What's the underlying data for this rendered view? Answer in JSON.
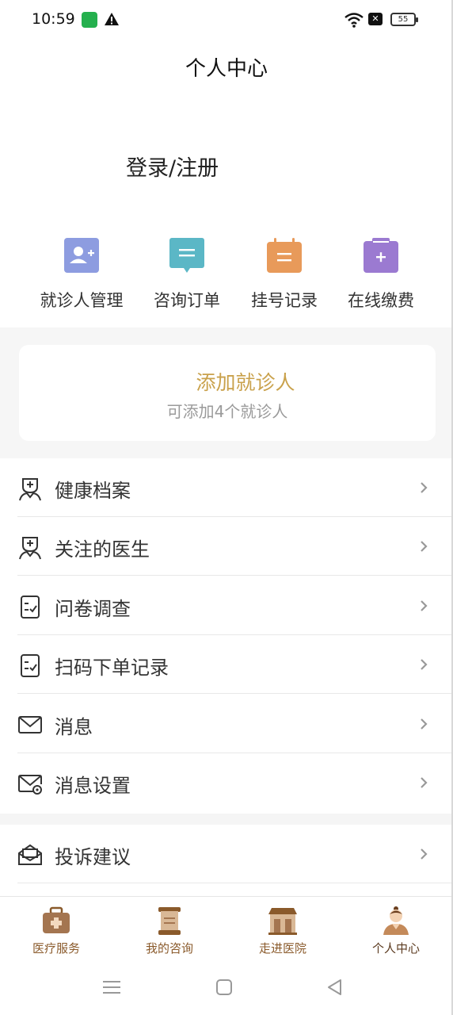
{
  "status_bar": {
    "time": "10:59",
    "battery": "55"
  },
  "header": {
    "title": "个人中心"
  },
  "login": {
    "label": "登录/注册"
  },
  "quick_actions": [
    {
      "label": "就诊人管理",
      "icon": "patient-manage-icon",
      "color": "#8d9ce0"
    },
    {
      "label": "咨询订单",
      "icon": "consult-order-icon",
      "color": "#5bb7c6"
    },
    {
      "label": "挂号记录",
      "icon": "register-record-icon",
      "color": "#e89a5a"
    },
    {
      "label": "在线缴费",
      "icon": "online-pay-icon",
      "color": "#9b7ad1"
    }
  ],
  "patient_card": {
    "title": "添加就诊人",
    "subtitle": "可添加4个就诊人"
  },
  "menu": [
    {
      "label": "健康档案",
      "icon": "health-record-icon"
    },
    {
      "label": "关注的医生",
      "icon": "followed-doctor-icon"
    },
    {
      "label": "问卷调查",
      "icon": "survey-icon"
    },
    {
      "label": "扫码下单记录",
      "icon": "scan-order-icon"
    },
    {
      "label": "消息",
      "icon": "mail-icon"
    },
    {
      "label": "消息设置",
      "icon": "mail-settings-icon"
    },
    {
      "label": "投诉建议",
      "icon": "complaint-icon"
    }
  ],
  "bottom_nav": [
    {
      "label": "医疗服务",
      "icon": "medical-kit-icon"
    },
    {
      "label": "我的咨询",
      "icon": "scroll-icon"
    },
    {
      "label": "走进医院",
      "icon": "hospital-icon"
    },
    {
      "label": "个人中心",
      "icon": "person-icon"
    }
  ],
  "colors": {
    "accent": "#c9a14b",
    "nav_text": "#8a5a2b"
  }
}
